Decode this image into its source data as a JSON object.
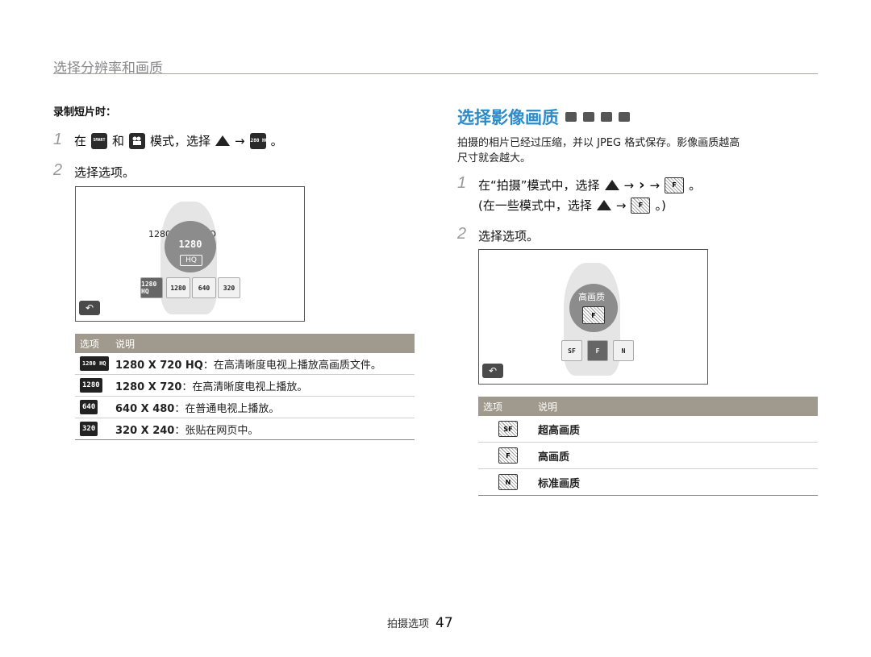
{
  "section_title": "选择分辨率和画质",
  "left": {
    "subhead": "录制短片时：",
    "step1": {
      "num": "1",
      "t1": "在",
      "icon1": "SMART",
      "t2": "和",
      "icon2": "movie-icon",
      "t3": "模式，选择",
      "arrow": "→",
      "icon3": "1280 HQ",
      "t4": "。"
    },
    "step2": {
      "num": "2",
      "text": "选择选项。"
    },
    "screen": {
      "label": "1280 X 720 HQ",
      "big_icon": "1280",
      "big_icon_sub": "HQ",
      "options": [
        "1280 HQ",
        "1280",
        "640",
        "320"
      ],
      "back": "↶"
    },
    "table": {
      "headers": [
        "选项",
        "说明"
      ],
      "rows": [
        {
          "icon": "1280 HQ",
          "bold": "1280 X 720 HQ",
          "desc": "：在高清晰度电视上播放高画质文件。"
        },
        {
          "icon": "1280",
          "bold": "1280 X 720",
          "desc": "：在高清晰度电视上播放。"
        },
        {
          "icon": "640",
          "bold": "640 X 480",
          "desc": "：在普通电视上播放。"
        },
        {
          "icon": "320",
          "bold": "320 X 240",
          "desc": "：张贴在网页中。"
        }
      ]
    }
  },
  "right": {
    "title": "选择影像画质",
    "intro_line1": "拍摄的相片已经过压缩，并以 JPEG 格式保存。影像画质越高",
    "intro_line2": "尺寸就会越大。",
    "step1": {
      "num": "1",
      "t1": "在“拍摄”模式中，选择",
      "arrow": "→",
      "t2": "。",
      "line2a": "(在一些模式中，选择",
      "line2b": "。)"
    },
    "step2": {
      "num": "2",
      "text": "选择选项。"
    },
    "screen": {
      "label": "高画质",
      "big_icon": "F",
      "options": [
        "SF",
        "F",
        "N"
      ],
      "back": "↶"
    },
    "table": {
      "headers": [
        "选项",
        "说明"
      ],
      "rows": [
        {
          "icon": "SF",
          "desc": "超高画质"
        },
        {
          "icon": "F",
          "desc": "高画质"
        },
        {
          "icon": "N",
          "desc": "标准画质"
        }
      ]
    }
  },
  "footer": {
    "label": "拍摄选项",
    "page": "47"
  }
}
